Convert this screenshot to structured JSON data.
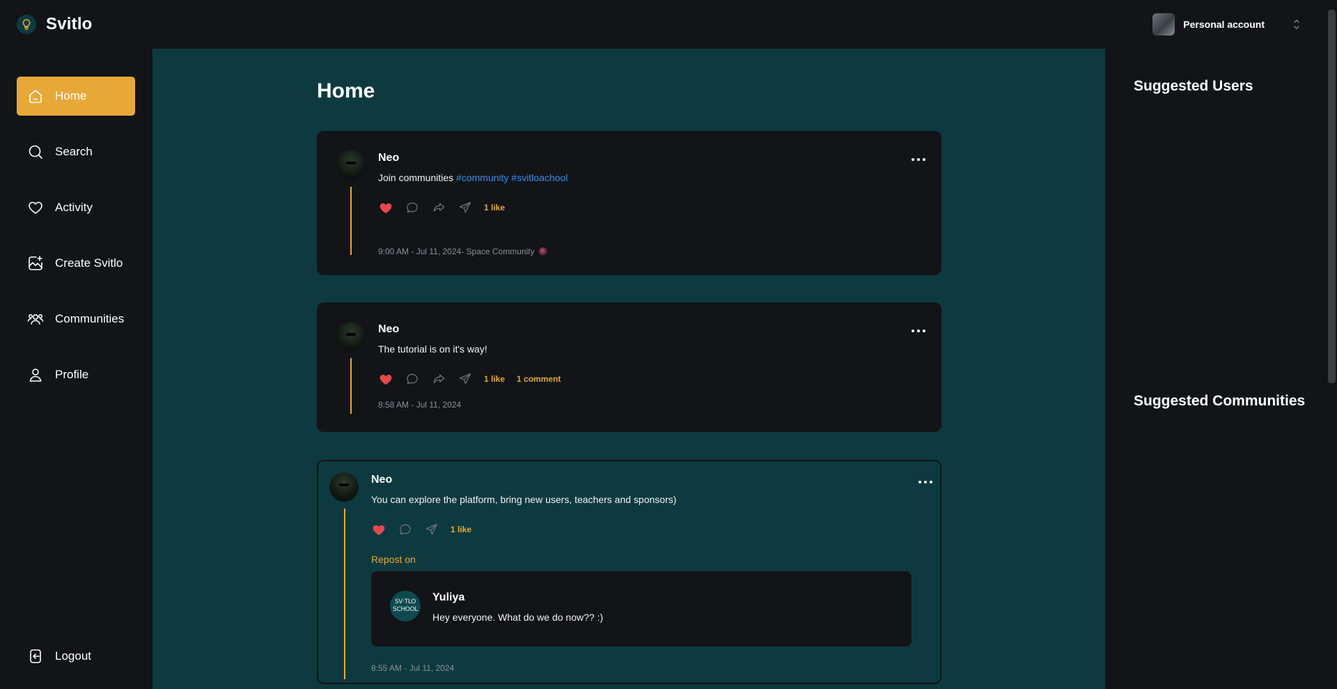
{
  "app": {
    "brand": "Svitlo",
    "account_label": "Personal account"
  },
  "colors": {
    "accent": "#e8a838",
    "main_bg": "#0d3a40",
    "panel_bg": "#121417",
    "hashtag": "#3b8fe8",
    "like": "#e5484d"
  },
  "sidebar": {
    "items": [
      {
        "label": "Home",
        "icon": "home-icon",
        "active": true
      },
      {
        "label": "Search",
        "icon": "search-icon",
        "active": false
      },
      {
        "label": "Activity",
        "icon": "heart-icon",
        "active": false
      },
      {
        "label": "Create Svitlo",
        "icon": "image-plus-icon",
        "active": false
      },
      {
        "label": "Communities",
        "icon": "users-icon",
        "active": false
      },
      {
        "label": "Profile",
        "icon": "user-icon",
        "active": false
      }
    ],
    "logout": "Logout"
  },
  "main": {
    "title": "Home",
    "posts": [
      {
        "author": "Neo",
        "text": "Join communities ",
        "tags": [
          "#community",
          "#svitloachool"
        ],
        "likes": "1 like",
        "meta": "9:00 AM - Jul 11, 2024- Space Community"
      },
      {
        "author": "Neo",
        "text": "The tutorial is on it's way!",
        "likes": "1 like",
        "comments": "1 comment",
        "meta": "8:58 AM - Jul 11, 2024"
      },
      {
        "author": "Neo",
        "text": "You can explore the platform, bring new users, teachers and sponsors)",
        "likes": "1 like",
        "repost_label": "Repost on",
        "repost": {
          "author": "Yuliya",
          "avatar_text_1": "SV‧TLO",
          "avatar_text_2": "SCHOOL",
          "text": "Hey everyone. What do we do now?? :)"
        },
        "meta": "8:55 AM - Jul 11, 2024"
      }
    ]
  },
  "right": {
    "suggested_users": "Suggested Users",
    "suggested_communities": "Suggested Communities"
  }
}
